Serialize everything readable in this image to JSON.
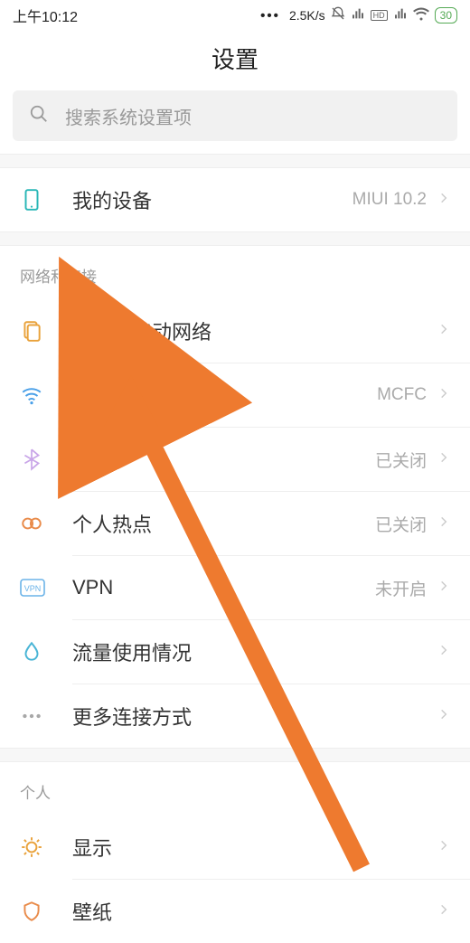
{
  "status_bar": {
    "time": "上午10:12",
    "speed": "2.5K/s",
    "battery_pct": "30"
  },
  "header": {
    "title": "设置"
  },
  "search": {
    "placeholder": "搜索系统设置项"
  },
  "sections": {
    "device": {
      "item": {
        "label": "我的设备",
        "value": "MIUI 10.2"
      }
    },
    "network": {
      "title": "网络和连接",
      "items": [
        {
          "key": "sim",
          "label": "双卡和移动网络",
          "value": ""
        },
        {
          "key": "wlan",
          "label": "WLAN",
          "value": "MCFC"
        },
        {
          "key": "bt",
          "label": "蓝牙",
          "value": "已关闭"
        },
        {
          "key": "hotspot",
          "label": "个人热点",
          "value": "已关闭"
        },
        {
          "key": "vpn",
          "label": "VPN",
          "value": "未开启"
        },
        {
          "key": "data",
          "label": "流量使用情况",
          "value": ""
        },
        {
          "key": "more",
          "label": "更多连接方式",
          "value": ""
        }
      ]
    },
    "personal": {
      "title": "个人",
      "items": [
        {
          "key": "display",
          "label": "显示",
          "value": ""
        },
        {
          "key": "wallpaper",
          "label": "壁纸",
          "value": ""
        }
      ]
    }
  },
  "icons": {
    "search": "search-icon",
    "chevron": "chevron-right-icon"
  },
  "colors": {
    "teal": "#29b7b7",
    "gray": "#a8a8a8",
    "orange_arrow": "#ee7a2f"
  }
}
